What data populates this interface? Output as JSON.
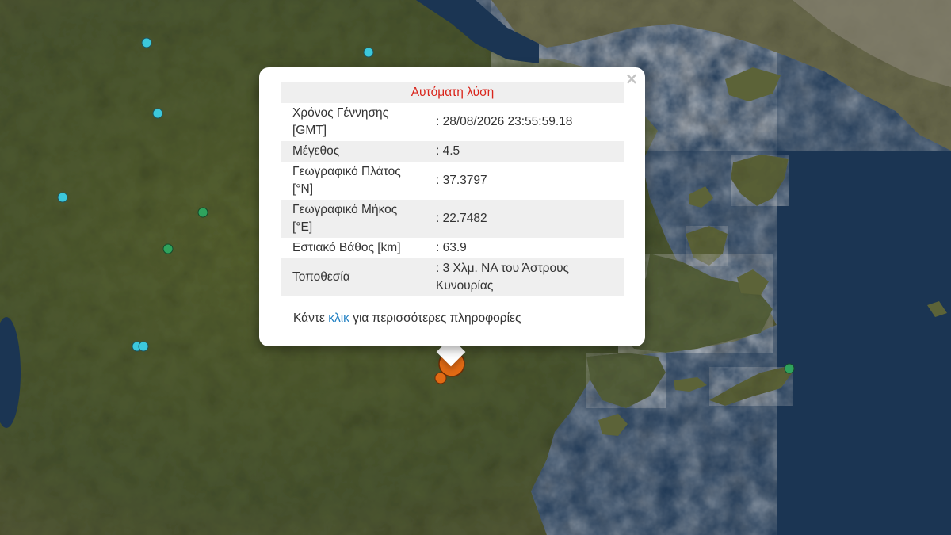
{
  "popup": {
    "title": "Αυτόματη λύση",
    "close_symbol": "×",
    "rows": [
      {
        "key": "Χρόνος Γέννησης [GMT]",
        "value": ": 28/08/2026 23:55:59.18"
      },
      {
        "key": "Μέγεθος",
        "value": ": 4.5"
      },
      {
        "key": "Γεωγραφικό Πλάτος [°N]",
        "value": ": 37.3797"
      },
      {
        "key": "Γεωγραφικό Μήκος [°E]",
        "value": ": 22.7482"
      },
      {
        "key": "Εστιακό Βάθος [km]",
        "value": ": 63.9"
      },
      {
        "key": "Τοποθεσία",
        "value": ": 3 Χλμ. ΝΑ του Άστρους Κυνουρίας"
      }
    ],
    "footer_pre": "Κάντε ",
    "footer_link": "κλικ",
    "footer_post": " για περισσότερες πληροφορίες"
  },
  "colors": {
    "sea": "#1b3553",
    "land": "#4f5b33",
    "cyan_marker": "#3cc8dc",
    "green_marker": "#2fa35d",
    "orange_marker": "#e16a14",
    "title_red": "#d9261c",
    "link_blue": "#1f7fc2"
  }
}
